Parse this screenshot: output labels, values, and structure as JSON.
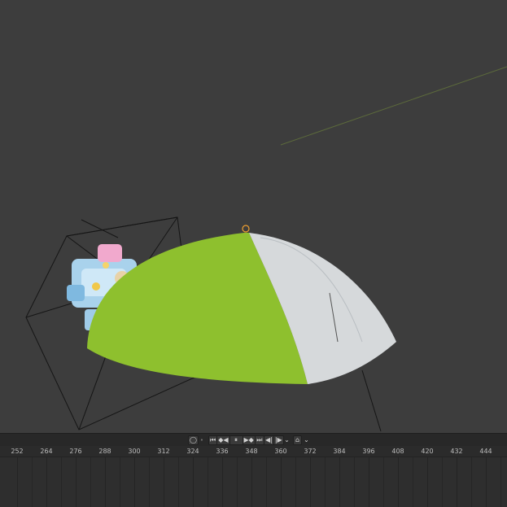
{
  "viewport": {
    "background": "#3d3d3d",
    "objects": {
      "dome_green": "#8ec02e",
      "dome_white": "#d6d9db",
      "camera_wire": "#151515",
      "selection_outline": "#f0a030"
    }
  },
  "playback": {
    "buttons": [
      {
        "icon": "record-icon",
        "glyph": "◯"
      },
      {
        "icon": "jump-start-icon",
        "glyph": "⏮"
      },
      {
        "icon": "prev-keyframe-icon",
        "glyph": "◆◀"
      },
      {
        "icon": "pause-icon",
        "glyph": "⏸"
      },
      {
        "icon": "next-keyframe-icon",
        "glyph": "▶◆"
      },
      {
        "icon": "jump-end-icon",
        "glyph": "⏭"
      },
      {
        "icon": "step-back-icon",
        "glyph": "◀|"
      },
      {
        "icon": "step-forward-icon",
        "glyph": "|▶"
      },
      {
        "icon": "dropdown-icon",
        "glyph": "⌄"
      },
      {
        "icon": "auto-keying-icon",
        "glyph": "⌂"
      },
      {
        "icon": "keying-dropdown-icon",
        "glyph": "⌄"
      }
    ]
  },
  "timeline": {
    "frames": [
      "252",
      "264",
      "276",
      "288",
      "300",
      "312",
      "324",
      "336",
      "348",
      "360",
      "372",
      "384",
      "396",
      "408",
      "420",
      "432",
      "444"
    ],
    "colors": {
      "ruler_bg": "#2b2b2b",
      "area_bg": "#2e2e2e",
      "label": "#bdbdbd"
    }
  }
}
